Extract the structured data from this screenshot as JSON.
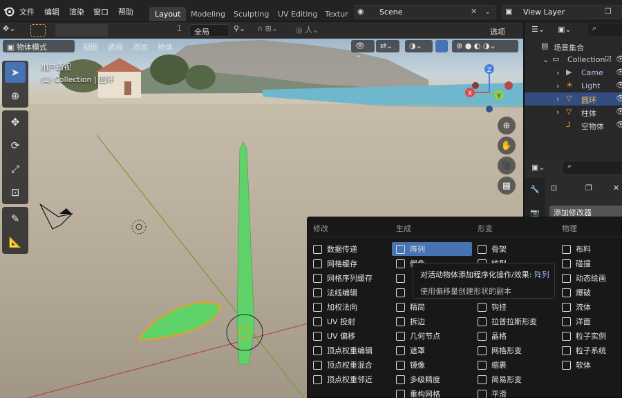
{
  "topbar": {
    "menus": [
      "文件",
      "编辑",
      "渲染",
      "窗口",
      "帮助"
    ],
    "workspaces": [
      "Layout",
      "Modeling",
      "Sculpting",
      "UV Editing",
      "Textur"
    ],
    "active_workspace": "Layout",
    "scene_label": "Scene",
    "view_layer_label": "View Layer"
  },
  "toolrow": {
    "transform_orientation": "全局",
    "options_label": "选项"
  },
  "viewport": {
    "mode_label": "物体模式",
    "menu": [
      "视图",
      "选择",
      "添加",
      "物体"
    ],
    "overlay_line1": "用户透视",
    "overlay_line2": "(1) Collection | 圆环",
    "gizmo": {
      "z": "Z",
      "x": "X",
      "y": "Y"
    }
  },
  "modifier_menu": {
    "columns": [
      "修改",
      "生成",
      "形变",
      "物理"
    ],
    "modify": [
      "数据传递",
      "网格缓存",
      "网格序列缓存",
      "法线编辑",
      "加权法向",
      "UV 投射",
      "UV 偏移",
      "顶点权重编辑",
      "顶点权重混合",
      "顶点权重邻近"
    ],
    "generate": [
      "阵列",
      "倒角",
      "",
      "",
      "精简",
      "拆边",
      "几何节点",
      "遮罩",
      "镜像",
      "多级精度",
      "重构网格"
    ],
    "deform": [
      "骨架",
      "铸型",
      "",
      "",
      "钩挂",
      "拉普拉斯形变",
      "晶格",
      "网格形变",
      "缩裹",
      "简易形变",
      "平滑"
    ],
    "physics": [
      "布料",
      "碰撞",
      "动态绘画",
      "爆破",
      "流体",
      "洋面",
      "粒子实例",
      "粒子系统",
      "软体"
    ],
    "highlighted": "阵列"
  },
  "tooltip": {
    "line1_prefix": "对活动物体添加程序化操作/效果:",
    "line1_name": "阵列",
    "line2": "使用偏移量创建形状的副本"
  },
  "outliner": {
    "root": "场景集合",
    "collection": "Collection",
    "items": [
      "Came",
      "Light",
      "圆环",
      "柱体",
      "空物体"
    ],
    "selected": "圆环"
  },
  "properties": {
    "add_modifier_label": "添加修改器"
  },
  "colors": {
    "accent": "#4772b3",
    "selection_row": "#334d80",
    "mesh_green": "#5fd36a"
  }
}
